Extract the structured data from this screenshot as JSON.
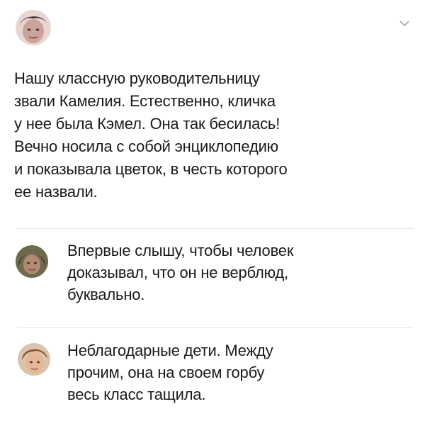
{
  "author": {
    "name": "",
    "meta": ""
  },
  "post": {
    "lines": [
      "Нашу классную руководительницу",
      "звали Камелия. Естественно, кличка",
      "у нее была Кэмел. Она так бесилась!",
      "Вечно носила с собой энциклопедию",
      "и показывала цветок, в честь которого",
      "ее назвали."
    ]
  },
  "comments": [
    {
      "lines": [
        "Впервые слышу, чтобы человек",
        "доказывал, что он не верблюд,",
        "буквально."
      ]
    },
    {
      "lines": [
        "Неблагодарные дети. Между",
        "прочим, она на своем горбу",
        "весь класс тащила."
      ]
    }
  ],
  "icons": {
    "menu": "chevron-down-icon"
  },
  "colors": {
    "text": "#1a1a1a",
    "divider": "#e3e3e3",
    "background": "#ffffff"
  }
}
